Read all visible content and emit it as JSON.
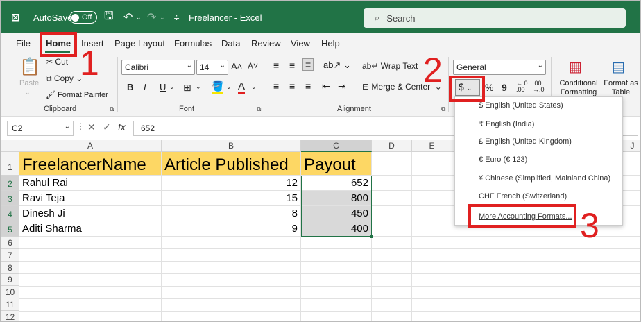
{
  "titlebar": {
    "autosave_label": "AutoSave",
    "autosave_state": "Off",
    "doc_title": "Freelancer",
    "app_name": "Excel",
    "search_placeholder": "Search",
    "bg_color": "#217346"
  },
  "tabs": [
    "File",
    "Home",
    "Insert",
    "Page Layout",
    "Formulas",
    "Data",
    "Review",
    "View",
    "Help"
  ],
  "active_tab": "Home",
  "clipboard": {
    "paste": "Paste",
    "cut": "Cut",
    "copy": "Copy",
    "format_painter": "Format Painter",
    "group": "Clipboard"
  },
  "font": {
    "name": "Calibri",
    "size": "14",
    "bold": "B",
    "italic": "I",
    "underline": "U",
    "group": "Font"
  },
  "alignment": {
    "wrap_text": "Wrap Text",
    "merge_center": "Merge & Center",
    "group": "Alignment"
  },
  "number": {
    "format": "General",
    "currency_symbol": "$",
    "percent": "%",
    "comma": "9"
  },
  "styles": {
    "conditional_formatting": "Conditional Formatting",
    "format_as_table": "Format as Table"
  },
  "formula_bar": {
    "name_box": "C2",
    "fx": "fx",
    "value": "652"
  },
  "columns": [
    "A",
    "B",
    "C",
    "D",
    "E",
    "F",
    "J"
  ],
  "rows": [
    "1",
    "2",
    "3",
    "4",
    "5",
    "6",
    "7",
    "8",
    "9",
    "10",
    "11",
    "12"
  ],
  "sheet": {
    "headers": [
      "FreelancerName",
      "Article Published",
      "Payout"
    ],
    "data": [
      [
        "Rahul Rai",
        "12",
        "652"
      ],
      [
        "Ravi Teja",
        "15",
        "800"
      ],
      [
        "Dinesh Ji",
        "8",
        "450"
      ],
      [
        "Aditi Sharma",
        "9",
        "400"
      ]
    ]
  },
  "accounting_dropdown": {
    "items": [
      "$ English (United States)",
      "₹ English (India)",
      "£ English (United Kingdom)",
      "€ Euro (€ 123)",
      "¥ Chinese (Simplified, Mainland China)",
      "CHF French (Switzerland)"
    ],
    "more": "More Accounting Formats..."
  },
  "annotations": [
    "1",
    "2",
    "3"
  ],
  "colors": {
    "accent": "#217346",
    "header_fill": "#fdd764",
    "annotation": "#e02020"
  }
}
